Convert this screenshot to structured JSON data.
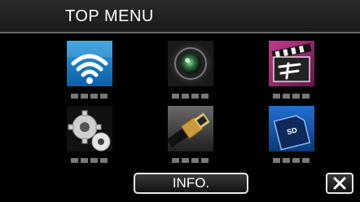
{
  "header": {
    "title": "TOP MENU"
  },
  "menu": [
    {
      "icon": "wifi-icon"
    },
    {
      "icon": "camera-lens-icon"
    },
    {
      "icon": "effect-icon"
    },
    {
      "icon": "settings-gears-icon"
    },
    {
      "icon": "hdmi-cable-icon"
    },
    {
      "icon": "sd-card-icon"
    }
  ],
  "footer": {
    "info_label": "INFO.",
    "close_icon": "close-icon"
  },
  "colors": {
    "background": "#000000",
    "header": "#1f1f1f",
    "dots": "#777777"
  }
}
